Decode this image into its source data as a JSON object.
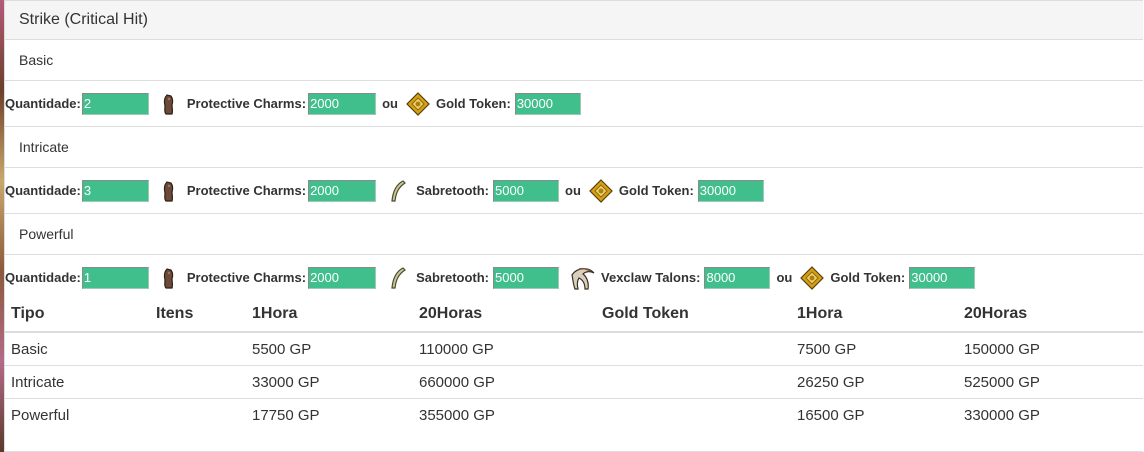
{
  "panel": {
    "title": "Strike (Critical Hit)"
  },
  "qty_label": "Quantidade:",
  "or_label": "ou",
  "sections": [
    {
      "title": "Basic",
      "quantity": "2",
      "items": [
        {
          "icon": "protective-charm-icon",
          "label": "Protective Charms:",
          "value": "2000"
        },
        {
          "icon": "gold-token-icon",
          "label": "Gold Token:",
          "value": "30000"
        }
      ]
    },
    {
      "title": "Intricate",
      "quantity": "3",
      "items": [
        {
          "icon": "protective-charm-icon",
          "label": "Protective Charms:",
          "value": "2000"
        },
        {
          "icon": "sabretooth-icon",
          "label": "Sabretooth:",
          "value": "5000"
        },
        {
          "icon": "gold-token-icon",
          "label": "Gold Token:",
          "value": "30000"
        }
      ]
    },
    {
      "title": "Powerful",
      "quantity": "1",
      "items": [
        {
          "icon": "protective-charm-icon",
          "label": "Protective Charms:",
          "value": "2000"
        },
        {
          "icon": "sabretooth-icon",
          "label": "Sabretooth:",
          "value": "5000"
        },
        {
          "icon": "vexclaw-talon-icon",
          "label": "Vexclaw Talons:",
          "value": "8000"
        },
        {
          "icon": "gold-token-icon",
          "label": "Gold Token:",
          "value": "30000"
        }
      ]
    }
  ],
  "table": {
    "headers": [
      "Tipo",
      "Itens",
      "1Hora",
      "20Horas",
      "Gold Token",
      "1Hora",
      "20Horas"
    ],
    "rows": [
      [
        "Basic",
        "",
        "5500 GP",
        "110000 GP",
        "",
        "7500 GP",
        "150000 GP"
      ],
      [
        "Intricate",
        "",
        "33000 GP",
        "660000 GP",
        "",
        "26250 GP",
        "525000 GP"
      ],
      [
        "Powerful",
        "",
        "17750 GP",
        "355000 GP",
        "",
        "16500 GP",
        "330000 GP"
      ]
    ]
  },
  "colors": {
    "input_bg": "#40bf8c",
    "heading_bg": "#f5f5f5",
    "border": "#dddddd"
  }
}
